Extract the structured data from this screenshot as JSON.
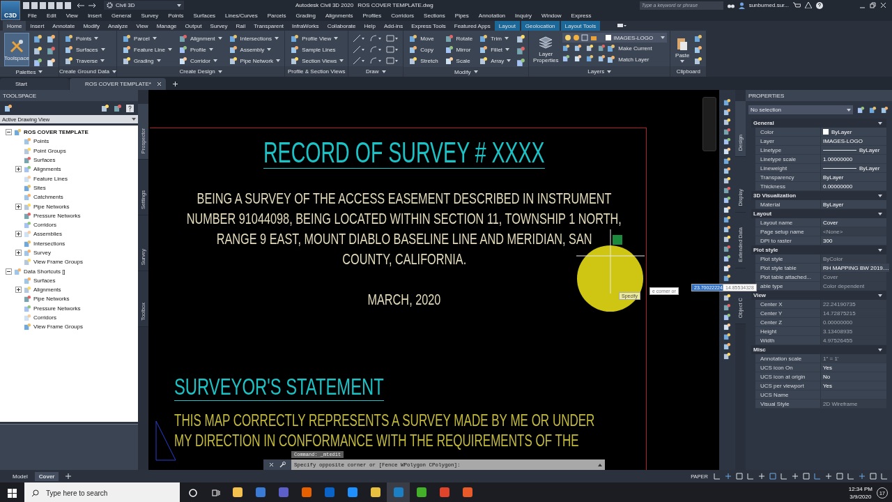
{
  "app_logo": "C3D",
  "title_bar": {
    "workspace": "Civil 3D",
    "app_title": "Autodesk Civil 3D 2020",
    "file_name": "ROS COVER TEMPLATE.dwg",
    "search": {
      "placeholder": "Type a keyword or phrase"
    },
    "user": "sunburned.sur..."
  },
  "menu": [
    "File",
    "Edit",
    "View",
    "Insert",
    "General",
    "Survey",
    "Points",
    "Surfaces",
    "Lines/Curves",
    "Parcels",
    "Grading",
    "Alignments",
    "Profiles",
    "Corridors",
    "Sections",
    "Pipes",
    "Annotation",
    "Inquiry",
    "Window",
    "Express"
  ],
  "ribbon_tabs": [
    {
      "label": "Home",
      "selected": true,
      "contextual": false
    },
    {
      "label": "Insert",
      "selected": false,
      "contextual": false
    },
    {
      "label": "Annotate",
      "selected": false,
      "contextual": false
    },
    {
      "label": "Modify",
      "selected": false,
      "contextual": false
    },
    {
      "label": "Analyze",
      "selected": false,
      "contextual": false
    },
    {
      "label": "View",
      "selected": false,
      "contextual": false
    },
    {
      "label": "Manage",
      "selected": false,
      "contextual": false
    },
    {
      "label": "Output",
      "selected": false,
      "contextual": false
    },
    {
      "label": "Survey",
      "selected": false,
      "contextual": false
    },
    {
      "label": "Rail",
      "selected": false,
      "contextual": false
    },
    {
      "label": "Transparent",
      "selected": false,
      "contextual": false
    },
    {
      "label": "InfraWorks",
      "selected": false,
      "contextual": false
    },
    {
      "label": "Collaborate",
      "selected": false,
      "contextual": false
    },
    {
      "label": "Help",
      "selected": false,
      "contextual": false
    },
    {
      "label": "Add-ins",
      "selected": false,
      "contextual": false
    },
    {
      "label": "Express Tools",
      "selected": false,
      "contextual": false
    },
    {
      "label": "Featured Apps",
      "selected": false,
      "contextual": false
    },
    {
      "label": "Layout",
      "selected": false,
      "contextual": true
    },
    {
      "label": "Geolocation",
      "selected": false,
      "contextual": true
    },
    {
      "label": "Layout Tools",
      "selected": false,
      "contextual": true
    }
  ],
  "ribbon_panels": [
    {
      "kind": "palette",
      "title": "Palettes",
      "expandable": true,
      "large": "Toolspace"
    },
    {
      "kind": "standard",
      "title": "Create Ground Data",
      "expandable": true,
      "columns": [
        [
          {
            "label": "Points",
            "dropdown": true
          },
          {
            "label": "Surfaces",
            "dropdown": true
          },
          {
            "label": "Traverse",
            "dropdown": true
          }
        ]
      ]
    },
    {
      "kind": "standard",
      "title": "Create Design",
      "expandable": true,
      "columns": [
        [
          {
            "label": "Parcel",
            "dropdown": true
          },
          {
            "label": "Feature Line",
            "dropdown": true
          },
          {
            "label": "Grading",
            "dropdown": true
          }
        ],
        [
          {
            "label": "Alignment",
            "dropdown": true
          },
          {
            "label": "Profile",
            "dropdown": true
          },
          {
            "label": "Corridor",
            "dropdown": true
          }
        ],
        [
          {
            "label": "Intersections",
            "dropdown": true
          },
          {
            "label": "Assembly",
            "dropdown": true
          },
          {
            "label": "Pipe Network",
            "dropdown": true
          }
        ]
      ]
    },
    {
      "kind": "standard",
      "title": "Profile & Section Views",
      "expandable": false,
      "columns": [
        [
          {
            "label": "Profile View",
            "dropdown": true
          },
          {
            "label": "Sample Lines",
            "dropdown": false
          },
          {
            "label": "Section Views",
            "dropdown": true
          }
        ]
      ]
    },
    {
      "kind": "draw",
      "title": "Draw",
      "expandable": true
    },
    {
      "kind": "modify",
      "title": "Modify",
      "expandable": true,
      "columns": [
        [
          {
            "label": "Move",
            "dropdown": false
          },
          {
            "label": "Copy",
            "dropdown": false
          },
          {
            "label": "Stretch",
            "dropdown": false
          }
        ],
        [
          {
            "label": "Rotate",
            "dropdown": false
          },
          {
            "label": "Mirror",
            "dropdown": false
          },
          {
            "label": "Scale",
            "dropdown": false
          }
        ],
        [
          {
            "label": "Trim",
            "dropdown": true
          },
          {
            "label": "Fillet",
            "dropdown": true
          },
          {
            "label": "Array",
            "dropdown": true
          }
        ]
      ]
    },
    {
      "kind": "layers",
      "title": "Layers",
      "expandable": true,
      "large": "Layer Properties",
      "layer_select": "IMAGES-LOGO",
      "columns": [
        [
          {
            "label": "Make Current",
            "dropdown": false
          },
          {
            "label": "Match Layer",
            "dropdown": false
          }
        ]
      ]
    },
    {
      "kind": "clipboard",
      "title": "Clipboard",
      "expandable": false,
      "large": "Paste"
    }
  ],
  "doc_tabs": [
    {
      "label": "Start",
      "selected": false,
      "closable": false
    },
    {
      "label": "ROS COVER TEMPLATE*",
      "selected": true,
      "closable": true
    }
  ],
  "toolspace": {
    "title": "TOOLSPACE",
    "view": "Active Drawing View",
    "side_tabs": [
      {
        "label": "Prospector",
        "selected": true
      },
      {
        "label": "Settings",
        "selected": false
      },
      {
        "label": "Survey",
        "selected": false
      },
      {
        "label": "Toolbox",
        "selected": false
      }
    ],
    "tree": [
      {
        "label": "ROS COVER TEMPLATE",
        "bold": true,
        "expandable": true,
        "expanded": true,
        "children": [
          {
            "label": "Points",
            "expandable": false
          },
          {
            "label": "Point Groups",
            "expandable": false
          },
          {
            "label": "Surfaces",
            "expandable": false
          },
          {
            "label": "Alignments",
            "expandable": true,
            "expanded": false
          },
          {
            "label": "Feature Lines",
            "expandable": false
          },
          {
            "label": "Sites",
            "expandable": false
          },
          {
            "label": "Catchments",
            "expandable": false
          },
          {
            "label": "Pipe Networks",
            "expandable": true,
            "expanded": false
          },
          {
            "label": "Pressure Networks",
            "expandable": false
          },
          {
            "label": "Corridors",
            "expandable": false
          },
          {
            "label": "Assemblies",
            "expandable": true,
            "expanded": false
          },
          {
            "label": "Intersections",
            "expandable": false
          },
          {
            "label": "Survey",
            "expandable": true,
            "expanded": false
          },
          {
            "label": "View Frame Groups",
            "expandable": false
          }
        ]
      },
      {
        "label": "Data Shortcuts []",
        "bold": false,
        "expandable": true,
        "expanded": true,
        "children": [
          {
            "label": "Surfaces",
            "expandable": false
          },
          {
            "label": "Alignments",
            "expandable": true,
            "expanded": false
          },
          {
            "label": "Pipe Networks",
            "expandable": false
          },
          {
            "label": "Pressure Networks",
            "expandable": false
          },
          {
            "label": "Corridors",
            "expandable": false
          },
          {
            "label": "View Frame Groups",
            "expandable": false
          }
        ]
      }
    ]
  },
  "drawing": {
    "title": "RECORD OF SURVEY # XXXX",
    "description_lines": [
      "BEING A SURVEY OF THE ACCESS EASEMENT DESCRIBED IN INSTRUMENT",
      "NUMBER 91044098, BEING LOCATED WITHIN SECTION 11, TOWNSHIP 1 NORTH,",
      "RANGE 9 EAST, MOUNT DIABLO BASELINE LINE AND MERIDIAN, SAN",
      "COUNTY, CALIFORNIA."
    ],
    "date": "MARCH, 2020",
    "statement_title": "SURVEYOR'S STATEMENT",
    "statement_lines": [
      "THIS MAP CORRECTLY REPRESENTS A SURVEY MADE BY ME OR UNDER",
      "MY DIRECTION IN CONFORMANCE WITH THE REQUIREMENTS OF THE"
    ]
  },
  "dynamic_input": {
    "prompt": "Specify",
    "hint": "e corner or",
    "x_value": "23.70022224",
    "y_value": "14.85534328"
  },
  "command_line": {
    "history": "Command:  _mtedit",
    "prompt": "Specify opposite corner or [Fence WPolygon CPolygon]:"
  },
  "properties": {
    "title": "PROPERTIES",
    "selection": "No selection",
    "side_tabs": [
      {
        "label": "Design",
        "selected": true
      },
      {
        "label": "Display",
        "selected": false
      },
      {
        "label": "Extended Data",
        "selected": false
      },
      {
        "label": "Object C",
        "selected": false
      }
    ],
    "sections": [
      {
        "title": "General",
        "expanded": true,
        "rows": [
          {
            "label": "Color",
            "value": "ByLayer",
            "kind": "swatch",
            "disabled": false
          },
          {
            "label": "Layer",
            "value": "IMAGES-LOGO",
            "kind": "text",
            "disabled": false
          },
          {
            "label": "Linetype",
            "value": "ByLayer",
            "kind": "line",
            "disabled": false
          },
          {
            "label": "Linetype scale",
            "value": "1.00000000",
            "kind": "text",
            "disabled": false
          },
          {
            "label": "Lineweight",
            "value": "ByLayer",
            "kind": "line",
            "disabled": false
          },
          {
            "label": "Transparency",
            "value": "ByLayer",
            "kind": "text",
            "disabled": false
          },
          {
            "label": "Thickness",
            "value": "0.00000000",
            "kind": "text",
            "disabled": false
          }
        ]
      },
      {
        "title": "3D Visualization",
        "expanded": true,
        "rows": [
          {
            "label": "Material",
            "value": "ByLayer",
            "kind": "text",
            "disabled": false
          }
        ]
      },
      {
        "title": "Layout",
        "expanded": true,
        "rows": [
          {
            "label": "Layout name",
            "value": "Cover",
            "kind": "text",
            "disabled": false
          },
          {
            "label": "Page setup name",
            "value": "<None>",
            "kind": "text",
            "disabled": true
          },
          {
            "label": "DPI to raster",
            "value": "300",
            "kind": "text",
            "disabled": false
          }
        ]
      },
      {
        "title": "Plot style",
        "expanded": true,
        "rows": [
          {
            "label": "Plot style",
            "value": "ByColor",
            "kind": "text",
            "disabled": true
          },
          {
            "label": "Plot style table",
            "value": "RH MAPPING BW 2019....",
            "kind": "text",
            "disabled": false
          },
          {
            "label": "Plot table attached...",
            "value": "Cover",
            "kind": "text",
            "disabled": true
          },
          {
            "label": "able type",
            "value": "Color dependent",
            "kind": "text",
            "disabled": true
          }
        ]
      },
      {
        "title": "View",
        "expanded": true,
        "rows": [
          {
            "label": "Center X",
            "value": "22.24190735",
            "kind": "text",
            "disabled": true
          },
          {
            "label": "Center Y",
            "value": "14.72875215",
            "kind": "text",
            "disabled": true
          },
          {
            "label": "Center Z",
            "value": "0.00000000",
            "kind": "text",
            "disabled": true
          },
          {
            "label": "Height",
            "value": "3.13408935",
            "kind": "text",
            "disabled": true
          },
          {
            "label": "Width",
            "value": "4.97526455",
            "kind": "text",
            "disabled": true
          }
        ]
      },
      {
        "title": "Misc",
        "expanded": true,
        "rows": [
          {
            "label": "Annotation scale",
            "value": "1\" = 1'",
            "kind": "text",
            "disabled": true
          },
          {
            "label": "UCS icon On",
            "value": "Yes",
            "kind": "text",
            "disabled": false
          },
          {
            "label": "UCS icon at origin",
            "value": "No",
            "kind": "text",
            "disabled": false
          },
          {
            "label": "UCS per viewport",
            "value": "Yes",
            "kind": "text",
            "disabled": false
          },
          {
            "label": "UCS Name",
            "kind": "text",
            "disabled": false
          },
          {
            "label": "Visual Style",
            "value": "2D Wireframe",
            "kind": "text",
            "disabled": true
          }
        ]
      }
    ]
  },
  "layout_tabs": [
    {
      "label": "Model",
      "selected": false
    },
    {
      "label": "Cover",
      "selected": true
    }
  ],
  "status_bar": {
    "space": "PAPER"
  },
  "taskbar": {
    "search": {
      "placeholder": "Type here to search"
    },
    "time": "12:34 PM",
    "date": "3/9/2020",
    "notifications": "17",
    "apps": [
      {
        "color": "#f2c14e",
        "selected": false
      },
      {
        "color": "#3a7bd5",
        "selected": false
      },
      {
        "color": "#5b5fc7",
        "selected": false
      },
      {
        "color": "#e66000",
        "selected": false
      },
      {
        "color": "#0a64c8",
        "selected": false
      },
      {
        "color": "#1e90ff",
        "selected": false
      },
      {
        "color": "#e8c040",
        "selected": false
      },
      {
        "color": "#1c7fc4",
        "selected": true
      },
      {
        "color": "#44b02a",
        "selected": false
      },
      {
        "color": "#e0442b",
        "selected": false
      },
      {
        "color": "#e85a2a",
        "selected": false
      }
    ]
  }
}
